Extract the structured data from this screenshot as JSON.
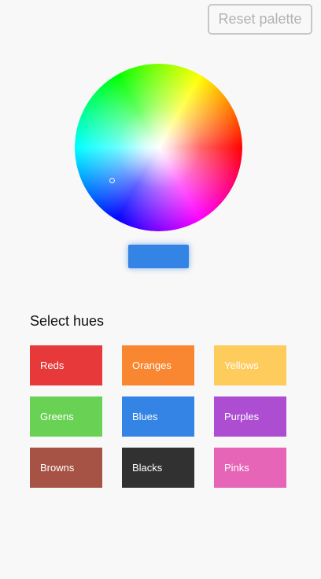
{
  "header": {
    "reset_label": "Reset palette"
  },
  "picker": {
    "selected_color": "#3384e4"
  },
  "hues": {
    "title": "Select hues",
    "items": [
      {
        "label": "Reds",
        "color": "#e8393a"
      },
      {
        "label": "Oranges",
        "color": "#f98731"
      },
      {
        "label": "Yellows",
        "color": "#fecb5d"
      },
      {
        "label": "Greens",
        "color": "#69d255"
      },
      {
        "label": "Blues",
        "color": "#3384e4"
      },
      {
        "label": "Purples",
        "color": "#ad4ed2"
      },
      {
        "label": "Browns",
        "color": "#a65244"
      },
      {
        "label": "Blacks",
        "color": "#313131"
      },
      {
        "label": "Pinks",
        "color": "#e765b7"
      }
    ]
  }
}
